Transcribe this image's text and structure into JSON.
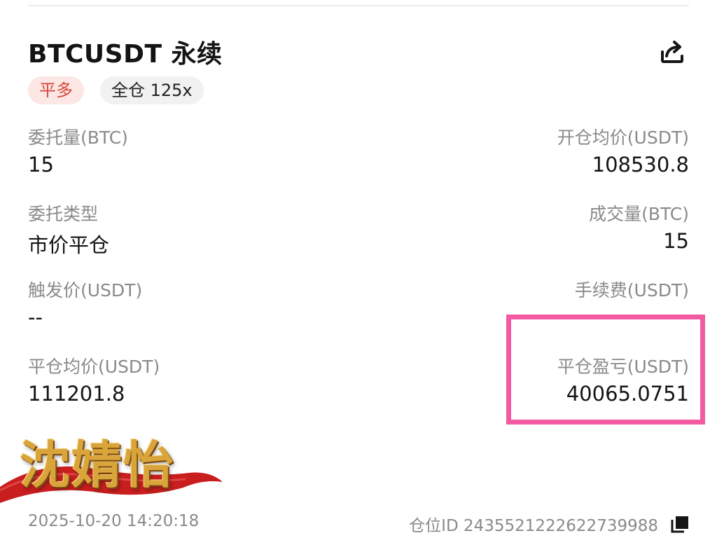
{
  "header": {
    "title": "BTCUSDT 永续"
  },
  "tags": {
    "side": "平多",
    "margin": "全仓 125x"
  },
  "fields": {
    "order_qty": {
      "label": "委托量(BTC)",
      "value": "15"
    },
    "open_avg_price": {
      "label": "开仓均价(USDT)",
      "value": "108530.8"
    },
    "order_type": {
      "label": "委托类型",
      "value": "市价平仓"
    },
    "filled_qty": {
      "label": "成交量(BTC)",
      "value": "15"
    },
    "trigger_price": {
      "label": "触发价(USDT)",
      "value": "--"
    },
    "fee": {
      "label": "手续费(USDT)",
      "value": ""
    },
    "close_avg_price": {
      "label": "平仓均价(USDT)",
      "value": "111201.8"
    },
    "close_pnl": {
      "label": "平仓盈亏(USDT)",
      "value": "40065.0751"
    }
  },
  "watermark": {
    "text": "沈婧怡"
  },
  "footer": {
    "time": "2025-10-20 14:20:18",
    "position_id": "仓位ID 2435521222622739988"
  },
  "icons": {
    "share": "share-icon",
    "copy": "copy-icon"
  },
  "colors": {
    "side_tag_text": "#d6453a",
    "side_tag_bg": "#fde7e4",
    "highlight": "#f25aa2",
    "watermark_gold": "#d9a43a",
    "ribbon_red": "#c81e1e"
  }
}
